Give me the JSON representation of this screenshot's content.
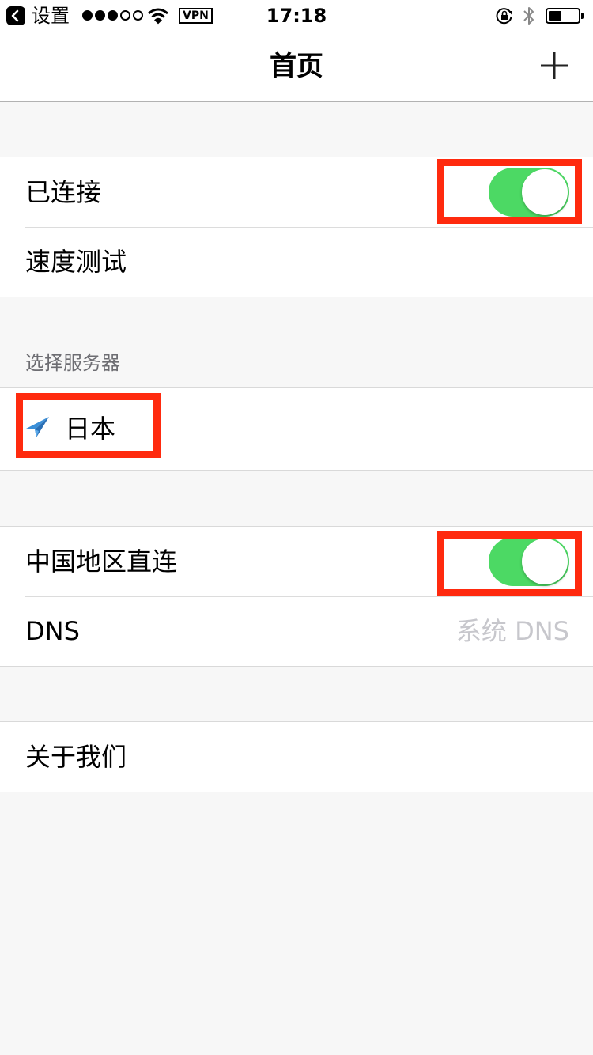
{
  "status_bar": {
    "back_label": "设置",
    "signal_bars_filled": 3,
    "signal_bars_total": 5,
    "vpn_label": "VPN",
    "time": "17:18",
    "battery_level": 0.45
  },
  "nav": {
    "title": "首页",
    "add_icon": "plus-icon"
  },
  "section_connection": {
    "connected_label": "已连接",
    "connected_on": true,
    "speed_test_label": "速度测试"
  },
  "section_server": {
    "header": "选择服务器",
    "server_icon": "paper-plane-icon",
    "selected_server": "日本"
  },
  "section_routing": {
    "china_direct_label": "中国地区直连",
    "china_direct_on": true,
    "dns_label": "DNS",
    "dns_value": "系统 DNS"
  },
  "section_about": {
    "about_label": "关于我们"
  },
  "colors": {
    "toggle_on": "#4cd964",
    "highlight": "#ff2a0e",
    "background": "#f7f7f7",
    "server_icon": "#3a8fd8"
  }
}
